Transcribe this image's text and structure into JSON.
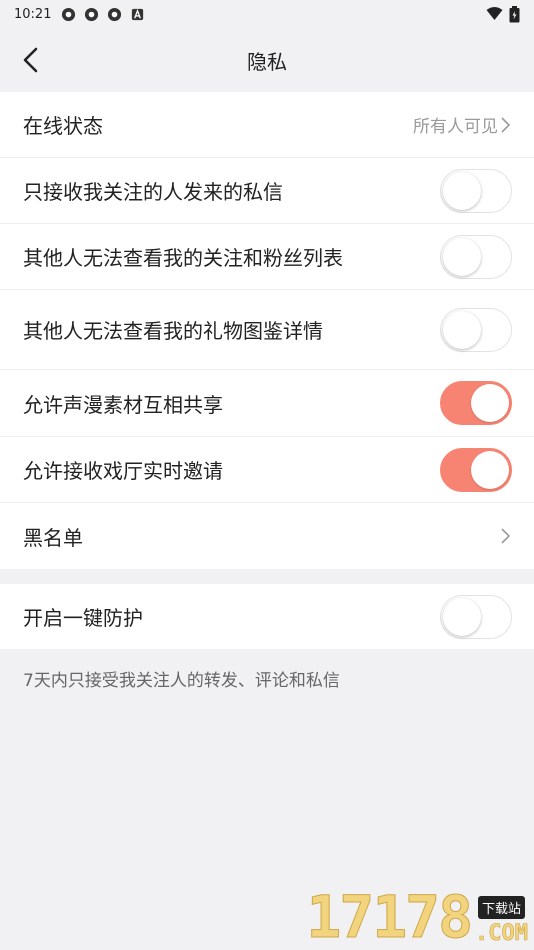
{
  "status_bar": {
    "time": "10:21",
    "icons": [
      "app-icon",
      "app-icon",
      "app-icon",
      "a-badge-icon"
    ],
    "right_icons": [
      "wifi-icon",
      "battery-icon"
    ]
  },
  "header": {
    "title": "隐私",
    "back_icon": "chevron-left-icon"
  },
  "settings": [
    {
      "label": "在线状态",
      "value": "所有人可见"
    },
    {
      "label": "只接收我关注的人发来的私信",
      "toggle": false
    },
    {
      "label": "其他人无法查看我的关注和粉丝列表",
      "toggle": false
    },
    {
      "label": "其他人无法查看我的礼物图鉴详情",
      "toggle": false
    },
    {
      "label": "允许声漫素材互相共享",
      "toggle": true
    },
    {
      "label": "允许接收戏厅实时邀请",
      "toggle": true
    },
    {
      "label": "黑名单"
    }
  ],
  "protection": {
    "label": "开启一键防护",
    "toggle": false,
    "note": "7天内只接受我关注人的转发、评论和私信"
  },
  "colors": {
    "accent": "#f78472",
    "background": "#f1f1f3"
  },
  "watermark": {
    "digits": "17178",
    "badge": "下载站",
    "suffix": ".COM"
  }
}
